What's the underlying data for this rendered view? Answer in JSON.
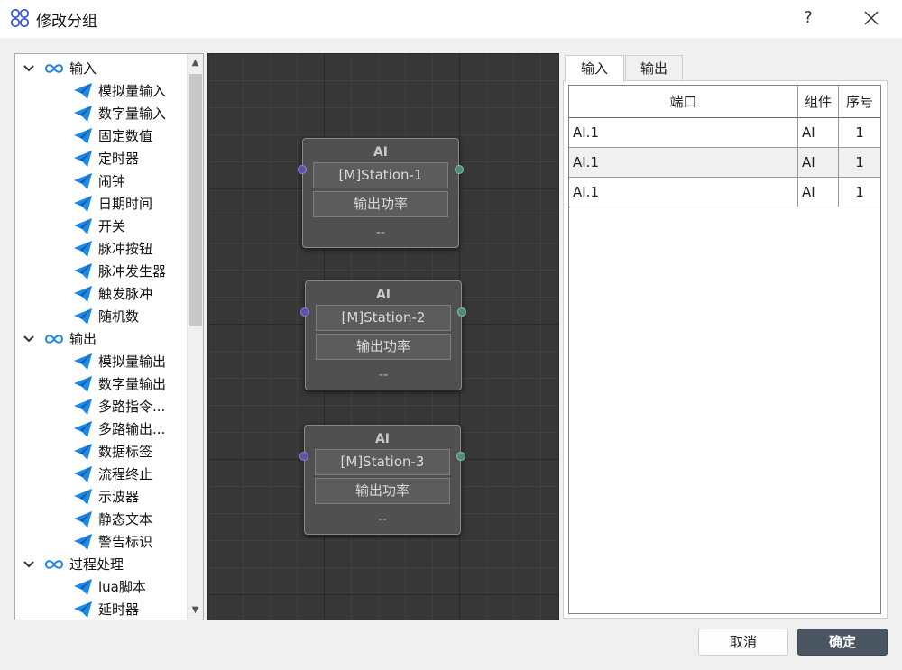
{
  "window": {
    "title": "修改分组",
    "help_label": "?"
  },
  "tree": {
    "groups": [
      {
        "label": "输入",
        "items": [
          "模拟量输入",
          "数字量输入",
          "固定数值",
          "定时器",
          "闹钟",
          "日期时间",
          "开关",
          "脉冲按钮",
          "脉冲发生器",
          "触发脉冲",
          "随机数"
        ]
      },
      {
        "label": "输出",
        "items": [
          "模拟量输出",
          "数字量输出",
          "多路指令...",
          "多路输出...",
          "数据标签",
          "流程终止",
          "示波器",
          "静态文本",
          "警告标识"
        ]
      },
      {
        "label": "过程处理",
        "items": [
          "lua脚本",
          "延时器"
        ]
      }
    ]
  },
  "nodes": [
    {
      "title": "AI",
      "station": "[M]Station-1",
      "output": "输出功率",
      "footer": "--"
    },
    {
      "title": "AI",
      "station": "[M]Station-2",
      "output": "输出功率",
      "footer": "--"
    },
    {
      "title": "AI",
      "station": "[M]Station-3",
      "output": "输出功率",
      "footer": "--"
    }
  ],
  "tabs": [
    {
      "label": "输入",
      "active": true
    },
    {
      "label": "输出",
      "active": false
    }
  ],
  "table": {
    "headers": [
      "端口",
      "组件",
      "序号"
    ],
    "rows": [
      [
        "AI.1",
        "AI",
        "1"
      ],
      [
        "AI.1",
        "AI",
        "1"
      ],
      [
        "AI.1",
        "AI",
        "1"
      ]
    ]
  },
  "buttons": {
    "cancel": "取消",
    "ok": "确定"
  },
  "colors": {
    "accent_blue": "#1e88e5",
    "canvas_bg": "#373737",
    "ok_button": "#4a5562"
  }
}
